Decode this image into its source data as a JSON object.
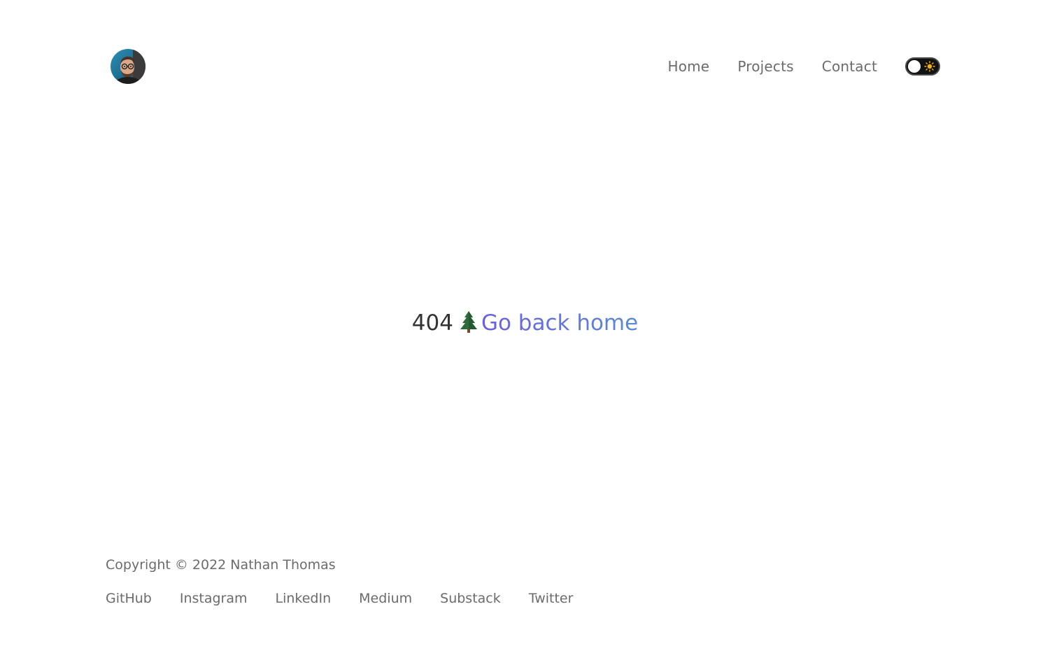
{
  "header": {
    "avatar_alt": "Nathan Thomas",
    "nav": [
      {
        "label": "Home"
      },
      {
        "label": "Projects"
      },
      {
        "label": "Contact"
      }
    ],
    "theme_toggle": {
      "state": "light",
      "icon": "sun-icon"
    }
  },
  "main": {
    "code": "404",
    "emoji": "tree-icon",
    "link_label": "Go back home"
  },
  "footer": {
    "copyright": "Copyright © 2022 Nathan Thomas",
    "links": [
      {
        "label": "GitHub"
      },
      {
        "label": "Instagram"
      },
      {
        "label": "LinkedIn"
      },
      {
        "label": "Medium"
      },
      {
        "label": "Substack"
      },
      {
        "label": "Twitter"
      }
    ]
  },
  "colors": {
    "text": "#6b6b6b",
    "heading": "#333333",
    "link_gradient_start": "#6a5fe0",
    "link_gradient_end": "#5a8ad8",
    "toggle_bg": "#121212",
    "sun": "#f5b400"
  }
}
